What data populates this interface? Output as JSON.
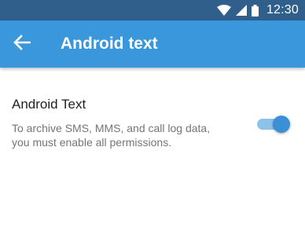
{
  "status_bar": {
    "time": "12:30",
    "icons": [
      "wifi-icon",
      "cellular-signal-icon",
      "battery-icon"
    ]
  },
  "app_bar": {
    "title": "Android text",
    "back_icon": "arrow-back-icon",
    "color": "#3a97dc"
  },
  "setting": {
    "title": "Android Text",
    "summary_line1": "To archive SMS, MMS, and call log data,",
    "summary_line2": "you must enable all permissions.",
    "toggle_on": true,
    "toggle_color": "#3a8fd6"
  }
}
